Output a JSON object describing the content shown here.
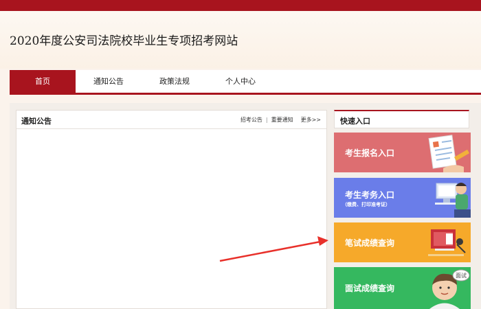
{
  "header": {
    "title": "2020年度公安司法院校毕业生专项招考网站"
  },
  "nav": {
    "items": [
      {
        "label": "首页"
      },
      {
        "label": "通知公告"
      },
      {
        "label": "政策法规"
      },
      {
        "label": "个人中心"
      }
    ]
  },
  "notice": {
    "title": "通知公告",
    "links": [
      "招考公告",
      "重要通知"
    ],
    "more": "更多>>"
  },
  "quick": {
    "title": "快速入口",
    "buttons": [
      {
        "label": "考生报名入口",
        "icon": "form-document-icon",
        "color": "#dd6e71"
      },
      {
        "label": "考生考务入口",
        "sub": "（缴费、打印准考证）",
        "icon": "person-computer-icon",
        "color": "#6a7de9"
      },
      {
        "label": "笔试成绩查询",
        "icon": "score-board-icon",
        "color": "#f6a92a"
      },
      {
        "label": "面试成绩查询",
        "icon": "interview-person-icon",
        "bubble": "面试",
        "color": "#35b85f"
      }
    ]
  },
  "colors": {
    "brand": "#a8141e",
    "arrow": "#e8302a"
  }
}
